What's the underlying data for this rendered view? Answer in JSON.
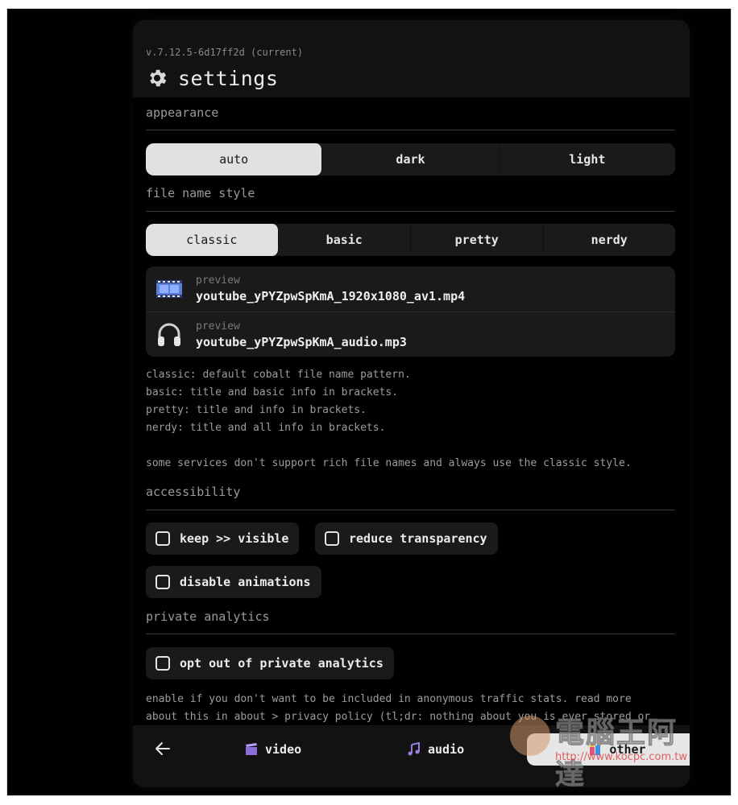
{
  "header": {
    "version": "v.7.12.5-6d17ff2d (current)",
    "title": "settings",
    "title_icon": "gear-icon"
  },
  "appearance": {
    "section_title": "appearance",
    "options": [
      "auto",
      "dark",
      "light"
    ],
    "selected": "auto"
  },
  "filename": {
    "section_title": "file name style",
    "options": [
      "classic",
      "basic",
      "pretty",
      "nerdy"
    ],
    "selected": "classic",
    "previews": [
      {
        "icon": "film-icon",
        "label": "preview",
        "name": "youtube_yPYZpwSpKmA_1920x1080_av1.mp4"
      },
      {
        "icon": "headphones-icon",
        "label": "preview",
        "name": "youtube_yPYZpwSpKmA_audio.mp3"
      }
    ],
    "description": [
      "classic: default cobalt file name pattern.",
      "basic: title and basic info in brackets.",
      "pretty: title and info in brackets.",
      "nerdy: title and all info in brackets.",
      "",
      "some services don't support rich file names and always use the classic style."
    ]
  },
  "accessibility": {
    "section_title": "accessibility",
    "options": [
      {
        "label": "keep >> visible",
        "checked": false
      },
      {
        "label": "reduce transparency",
        "checked": false
      },
      {
        "label": "disable animations",
        "checked": false
      }
    ]
  },
  "analytics": {
    "section_title": "private analytics",
    "option": {
      "label": "opt out of private analytics",
      "checked": false
    },
    "description": [
      "enable if you don't want to be included in anonymous traffic stats. read more",
      "about this in about > privacy policy (tl;dr: nothing about you is ever stored or"
    ]
  },
  "nav": {
    "back_icon": "arrow-left-icon",
    "tabs": [
      {
        "label": "video",
        "icon": "clapperboard-icon"
      },
      {
        "label": "audio",
        "icon": "music-notes-icon"
      },
      {
        "label": "other",
        "icon": "puzzle-icon"
      }
    ],
    "active": "other"
  },
  "watermark": {
    "text": "電腦王阿達",
    "url": "http://www.kocpc.com.tw"
  },
  "colors": {
    "background": "#000000",
    "panel": "#0f0f0f",
    "control": "#1a1a1a",
    "active": "#e1e1e1",
    "text": "#e6e6e6",
    "muted": "#9a9a9a"
  }
}
